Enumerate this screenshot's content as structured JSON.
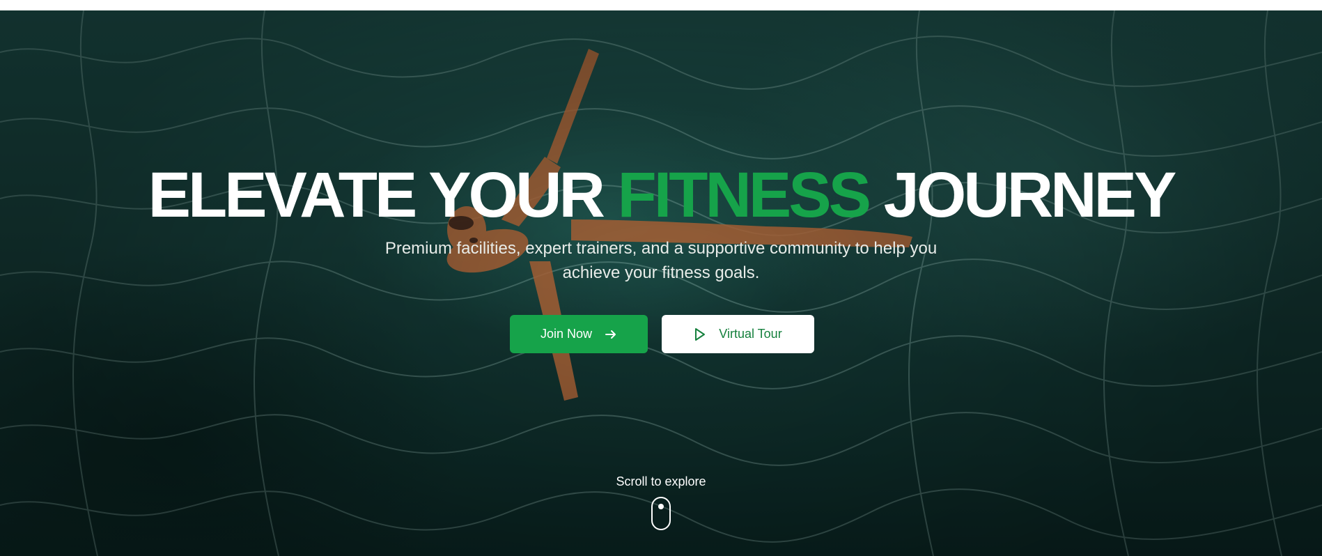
{
  "hero": {
    "headline_part1": "ELEVATE YOUR ",
    "headline_accent": "FITNESS",
    "headline_part2": " JOURNEY",
    "subtitle": "Premium facilities, expert trainers, and a supportive community to help you achieve your fitness goals.",
    "accent_color": "#16a34a",
    "background": "aerial photo of a person floating in a teal swimming pool"
  },
  "cta": {
    "primary_label": "Join Now",
    "primary_icon": "arrow-right-icon",
    "secondary_label": "Virtual Tour",
    "secondary_icon": "play-icon"
  },
  "scroll": {
    "label": "Scroll to explore",
    "icon": "mouse-scroll-icon"
  }
}
